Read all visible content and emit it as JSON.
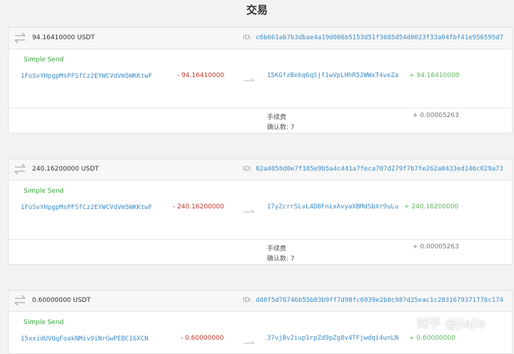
{
  "page": {
    "title": "交易"
  },
  "labels": {
    "id_prefix": "ID:",
    "simple_send": "Simple Send",
    "fee": "手续费",
    "confirmations_prefix": "确认数:"
  },
  "transactions": [
    {
      "amount_title": "94.16410000 USDT",
      "txid": "c6b661ab7b3dbae4a19d006b5153d51f3685d54d0023f33a04fbf41e956595d7",
      "from_address": "1FoSvYHpgpMsPFSfCz2EYWCVdVm5WKKtwF",
      "from_amount": "- 94.16410000",
      "to_address": "15KGfzBekq6qSjf1wVpLHhR52WWxT4veZa",
      "to_amount": "+ 94.16410000",
      "fee": "+ 0.00005263",
      "confirmations": "7"
    },
    {
      "amount_title": "240.16200000 USDT",
      "txid": "02a4058d0e7f105e9b5a4c441a7feca707d279f7b7fe262a0433ed146c029a73",
      "from_address": "1FoSvYHpgpMsPFSfCz2EYWCVdVm5WKKtwF",
      "from_amount": "- 240.16200000",
      "to_address": "17yZcrrSLvL4DBFnixAvyaXBMdSbXr9uLu",
      "to_amount": "+ 240.16200000",
      "fee": "+ 0.00005263",
      "confirmations": "7"
    },
    {
      "amount_title": "0.60000000 USDT",
      "txid": "d40f5d76746b55b03b9ff7d98fc6939e2b8c987d25eac1c2031679371776c174",
      "from_address": "15xxidUVQqFoakNMiv9iNrGwPEBC16XCN",
      "from_amount": "- 0.60000000",
      "to_address": "37vjBv2iup1rpZd9pZg8v4TFjwdqi4unLN",
      "to_amount": "+ 0.60000000"
    }
  ],
  "watermark": "知乎 @jiajia"
}
